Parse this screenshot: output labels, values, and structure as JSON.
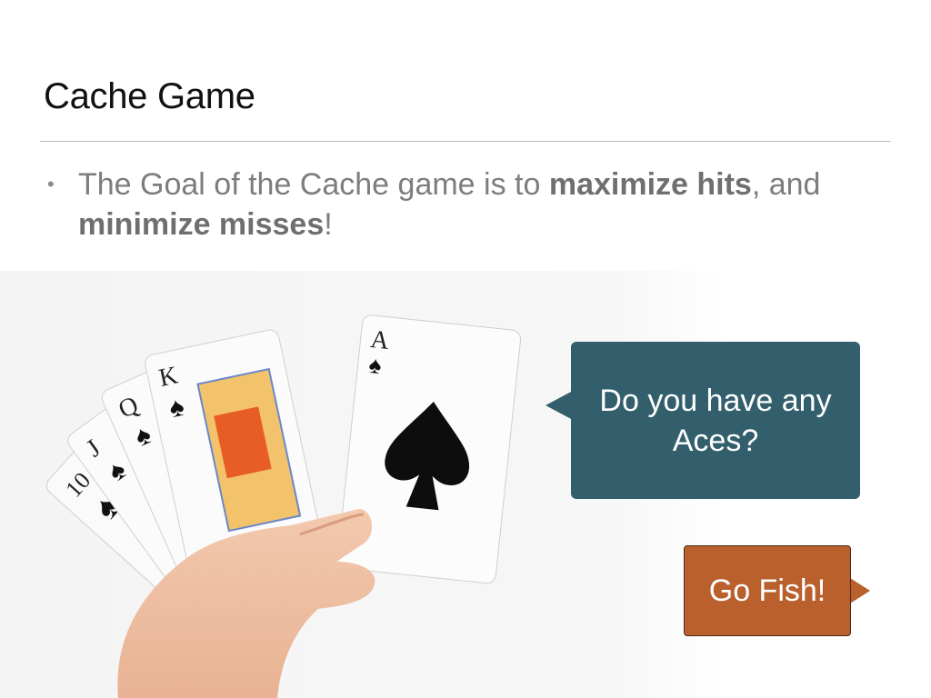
{
  "slide": {
    "title": "Cache Game",
    "bullet": {
      "text_1": "The Goal of the Cache game is to ",
      "bold_1": "maximize hits",
      "text_2": ", and ",
      "bold_2": "minimize misses",
      "text_3": "!"
    }
  },
  "cards": {
    "ranks": [
      "10",
      "J",
      "Q",
      "K",
      "A"
    ],
    "suit": "♠"
  },
  "bubbles": {
    "question": "Do you have any Aces?",
    "answer": "Go Fish!"
  },
  "colors": {
    "question_bubble": "#335f6d",
    "answer_bubble": "#b9602d"
  }
}
